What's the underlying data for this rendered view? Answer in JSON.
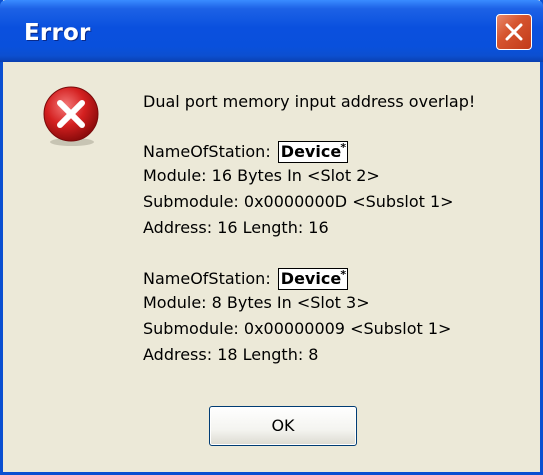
{
  "window": {
    "title": "Error",
    "close_icon": "close-icon",
    "error_icon": "error-icon"
  },
  "message": {
    "headline": "Dual port memory input address overlap!",
    "entries": [
      {
        "name_label": "NameOfStation:",
        "name_value": "Device",
        "name_mark": "*",
        "module": "Module: 16 Bytes In <Slot 2>",
        "submodule": "Submodule: 0x0000000D <Subslot 1>",
        "address": "Address: 16 Length: 16"
      },
      {
        "name_label": "NameOfStation:",
        "name_value": "Device",
        "name_mark": "*",
        "module": "Module: 8 Bytes In <Slot 3>",
        "submodule": "Submodule: 0x00000009 <Subslot 1>",
        "address": "Address: 18 Length: 8"
      }
    ]
  },
  "buttons": {
    "ok_label": "OK"
  },
  "colors": {
    "titlebar": "#0a50de",
    "dialog_bg": "#ece9d8",
    "close_button": "#d6552f",
    "error_red": "#d42020"
  }
}
